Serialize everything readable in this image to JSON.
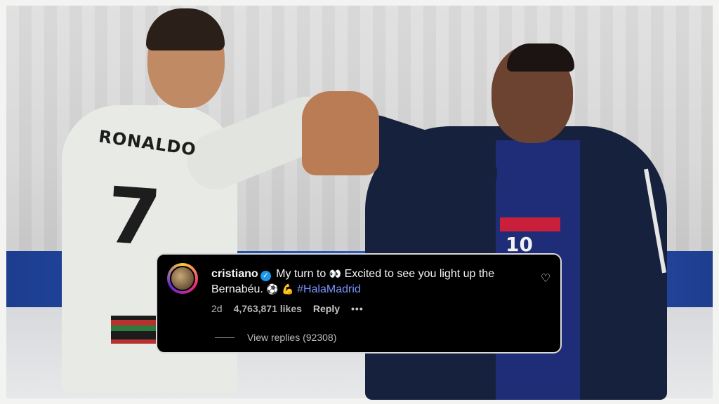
{
  "photo": {
    "jersey_name": "RONALDO",
    "jersey_number": "7",
    "player2_number": "10"
  },
  "comment": {
    "username": "cristiano",
    "verified_icon": "check-icon",
    "text_part1": "My turn to",
    "eyes_emoji": "👀",
    "text_part2": "Excited to see you light up the Bernabéu.",
    "ball_emoji": "⚽",
    "muscle_emoji": "💪",
    "hashtag": "#HalaMadrid",
    "time": "2d",
    "likes": "4,763,871 likes",
    "reply_label": "Reply",
    "more_label": "•••",
    "view_replies": "View replies (92308)",
    "heart_icon": "♡"
  },
  "colors": {
    "card_bg": "#000000",
    "hashtag": "#7993ff",
    "verified": "#1c96e8"
  }
}
